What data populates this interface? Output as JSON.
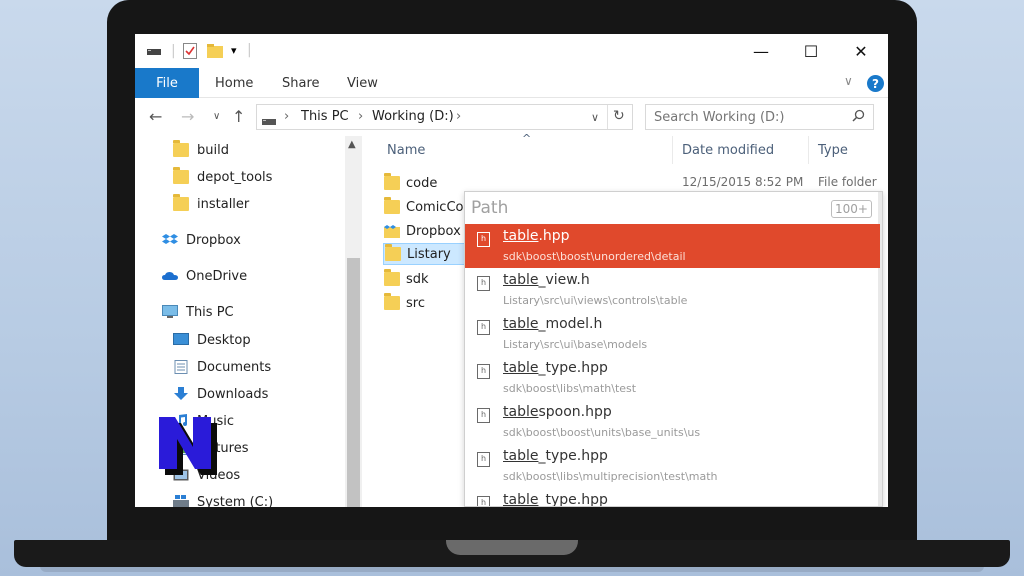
{
  "window": {
    "minimize": "—",
    "maximize": "☐",
    "close": "✕"
  },
  "ribbon": {
    "file": "File",
    "tabs": [
      "Home",
      "Share",
      "View"
    ],
    "help": "?"
  },
  "address": {
    "segments": [
      "This PC",
      "Working (D:)"
    ]
  },
  "search": {
    "placeholder": "Search Working (D:)"
  },
  "sidebar": {
    "items": [
      {
        "label": "build",
        "icon": "folder-icon"
      },
      {
        "label": "depot_tools",
        "icon": "folder-icon"
      },
      {
        "label": "installer",
        "icon": "folder-icon"
      },
      {
        "label": "Dropbox",
        "icon": "dropbox-icon"
      },
      {
        "label": "OneDrive",
        "icon": "onedrive-icon"
      },
      {
        "label": "This PC",
        "icon": "computer-icon"
      },
      {
        "label": "Desktop",
        "icon": "desktop-icon"
      },
      {
        "label": "Documents",
        "icon": "documents-icon"
      },
      {
        "label": "Downloads",
        "icon": "downloads-icon"
      },
      {
        "label": "Music",
        "icon": "music-icon"
      },
      {
        "label": "Pictures",
        "icon": "pictures-icon"
      },
      {
        "label": "Videos",
        "icon": "videos-icon"
      },
      {
        "label": "System (C:)",
        "icon": "drive-icon"
      }
    ]
  },
  "columns": {
    "name": "Name",
    "date": "Date modified",
    "type": "Type"
  },
  "files": [
    {
      "name": "code",
      "date": "12/15/2015 8:52 PM",
      "type": "File folder"
    },
    {
      "name": "ComicCo",
      "date": "",
      "type": ""
    },
    {
      "name": "Dropbox",
      "date": "",
      "type": ""
    },
    {
      "name": "Listary",
      "date": "",
      "type": ""
    },
    {
      "name": "sdk",
      "date": "",
      "type": ""
    },
    {
      "name": "src",
      "date": "",
      "type": ""
    }
  ],
  "listary": {
    "query": "Path",
    "count": "100+",
    "results": [
      {
        "match": "table",
        "rest": ".hpp",
        "path": "sdk\\boost\\boost\\unordered\\detail"
      },
      {
        "match": "table",
        "rest": "_view.h",
        "path": "Listary\\src\\ui\\views\\controls\\table"
      },
      {
        "match": "table",
        "rest": "_model.h",
        "path": "Listary\\src\\ui\\base\\models"
      },
      {
        "match": "table",
        "rest": "_type.hpp",
        "path": "sdk\\boost\\libs\\math\\test"
      },
      {
        "match": "table",
        "rest": "spoon.hpp",
        "path": "sdk\\boost\\boost\\units\\base_units\\us"
      },
      {
        "match": "table",
        "rest": "_type.hpp",
        "path": "sdk\\boost\\libs\\multiprecision\\test\\math"
      },
      {
        "match": "table",
        "rest": "_type.hpp",
        "path": ""
      }
    ]
  },
  "colors": {
    "accent": "#1979ca",
    "highlight": "#e0492c",
    "selection": "#cce8ff"
  }
}
